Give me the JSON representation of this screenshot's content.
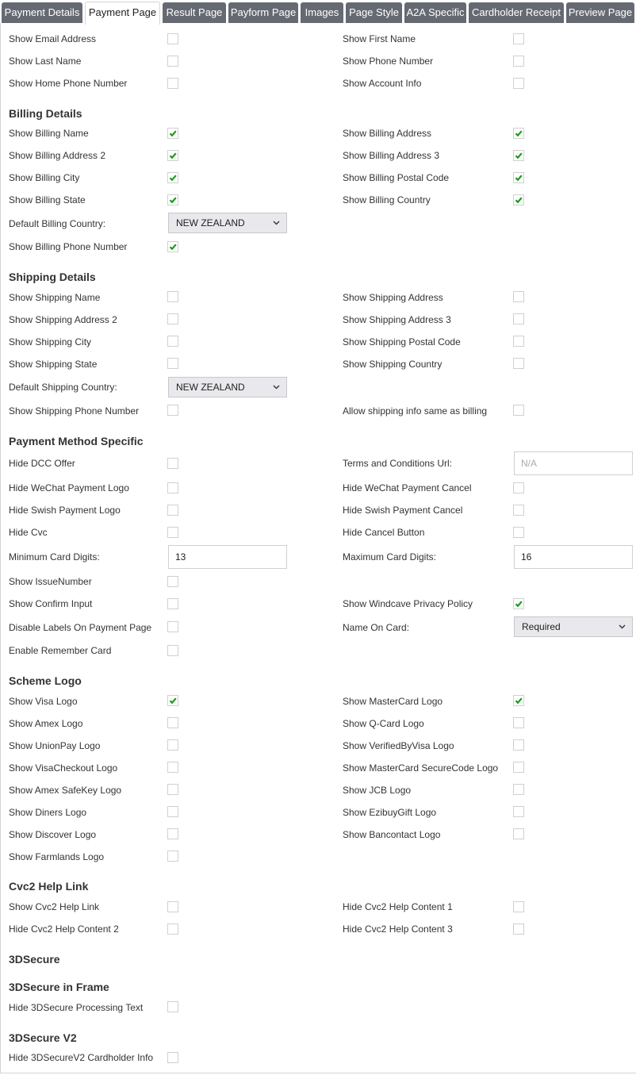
{
  "tabs": [
    {
      "label": "Payment Details",
      "active": false
    },
    {
      "label": "Payment Page",
      "active": true
    },
    {
      "label": "Result Page",
      "active": false
    },
    {
      "label": "Payform Page",
      "active": false
    },
    {
      "label": "Images",
      "active": false
    },
    {
      "label": "Page Style",
      "active": false
    },
    {
      "label": "A2A Specific",
      "active": false
    },
    {
      "label": "Cardholder Receipt",
      "active": false
    },
    {
      "label": "Preview Page",
      "active": false
    }
  ],
  "colors": {
    "tab_bg": "#656a72",
    "check_green": "#1a9a1a",
    "border": "#d4d4d4",
    "select_bg": "#e9e9ed"
  },
  "general": [
    {
      "label": "Show Email Address",
      "checked": false
    },
    {
      "label": "Show First Name",
      "checked": false
    },
    {
      "label": "Show Last Name",
      "checked": false
    },
    {
      "label": "Show Phone Number",
      "checked": false
    },
    {
      "label": "Show Home Phone Number",
      "checked": false
    },
    {
      "label": "Show Account Info",
      "checked": false
    }
  ],
  "billing": {
    "heading": "Billing Details",
    "items": [
      {
        "label": "Show Billing Name",
        "checked": true
      },
      {
        "label": "Show Billing Address",
        "checked": true
      },
      {
        "label": "Show Billing Address 2",
        "checked": true
      },
      {
        "label": "Show Billing Address 3",
        "checked": true
      },
      {
        "label": "Show Billing City",
        "checked": true
      },
      {
        "label": "Show Billing Postal Code",
        "checked": true
      },
      {
        "label": "Show Billing State",
        "checked": true
      },
      {
        "label": "Show Billing Country",
        "checked": true
      }
    ],
    "country_label": "Default Billing Country:",
    "country_value": "NEW ZEALAND",
    "phone": {
      "label": "Show Billing Phone Number",
      "checked": true
    }
  },
  "shipping": {
    "heading": "Shipping Details",
    "items": [
      {
        "label": "Show Shipping Name",
        "checked": false
      },
      {
        "label": "Show Shipping Address",
        "checked": false
      },
      {
        "label": "Show Shipping Address 2",
        "checked": false
      },
      {
        "label": "Show Shipping Address 3",
        "checked": false
      },
      {
        "label": "Show Shipping City",
        "checked": false
      },
      {
        "label": "Show Shipping Postal Code",
        "checked": false
      },
      {
        "label": "Show Shipping State",
        "checked": false
      },
      {
        "label": "Show Shipping Country",
        "checked": false
      }
    ],
    "country_label": "Default Shipping Country:",
    "country_value": "NEW ZEALAND",
    "phone": {
      "label": "Show Shipping Phone Number",
      "checked": false
    },
    "same_as_billing": {
      "label": "Allow shipping info same as billing",
      "checked": false
    }
  },
  "payment_method": {
    "heading": "Payment Method Specific",
    "hide_dcc": {
      "label": "Hide DCC Offer",
      "checked": false
    },
    "terms_label": "Terms and Conditions Url:",
    "terms_placeholder": "N/A",
    "hide_wechat_logo": {
      "label": "Hide WeChat Payment Logo",
      "checked": false
    },
    "hide_wechat_cancel": {
      "label": "Hide WeChat Payment Cancel",
      "checked": false
    },
    "hide_swish_logo": {
      "label": "Hide Swish Payment Logo",
      "checked": false
    },
    "hide_swish_cancel": {
      "label": "Hide Swish Payment Cancel",
      "checked": false
    },
    "hide_cvc": {
      "label": "Hide Cvc",
      "checked": false
    },
    "hide_cancel_button": {
      "label": "Hide Cancel Button",
      "checked": false
    },
    "min_digits_label": "Minimum Card Digits:",
    "min_digits_value": "13",
    "max_digits_label": "Maximum Card Digits:",
    "max_digits_value": "16",
    "show_issue_number": {
      "label": "Show IssueNumber",
      "checked": false
    },
    "show_confirm_input": {
      "label": "Show Confirm Input",
      "checked": false
    },
    "show_privacy_policy": {
      "label": "Show Windcave Privacy Policy",
      "checked": true
    },
    "disable_labels": {
      "label": "Disable Labels On Payment Page",
      "checked": false
    },
    "name_on_card_label": "Name On Card:",
    "name_on_card_value": "Required",
    "enable_remember_card": {
      "label": "Enable Remember Card",
      "checked": false
    }
  },
  "scheme_logo": {
    "heading": "Scheme Logo",
    "items": [
      {
        "label": "Show Visa Logo",
        "checked": true
      },
      {
        "label": "Show MasterCard Logo",
        "checked": true
      },
      {
        "label": "Show Amex Logo",
        "checked": false
      },
      {
        "label": "Show Q-Card Logo",
        "checked": false
      },
      {
        "label": "Show UnionPay Logo",
        "checked": false
      },
      {
        "label": "Show VerifiedByVisa Logo",
        "checked": false
      },
      {
        "label": "Show VisaCheckout Logo",
        "checked": false
      },
      {
        "label": "Show MasterCard SecureCode Logo",
        "checked": false
      },
      {
        "label": "Show Amex SafeKey Logo",
        "checked": false
      },
      {
        "label": "Show JCB Logo",
        "checked": false
      },
      {
        "label": "Show Diners Logo",
        "checked": false
      },
      {
        "label": "Show EzibuyGift Logo",
        "checked": false
      },
      {
        "label": "Show Discover Logo",
        "checked": false
      },
      {
        "label": "Show Bancontact Logo",
        "checked": false
      },
      {
        "label": "Show Farmlands Logo",
        "checked": false
      }
    ]
  },
  "cvc2": {
    "heading": "Cvc2 Help Link",
    "items": [
      {
        "label": "Show Cvc2 Help Link",
        "checked": false
      },
      {
        "label": "Hide Cvc2 Help Content 1",
        "checked": false
      },
      {
        "label": "Hide Cvc2 Help Content 2",
        "checked": false
      },
      {
        "label": "Hide Cvc2 Help Content 3",
        "checked": false
      }
    ]
  },
  "three_d_secure": {
    "heading": "3DSecure"
  },
  "three_d_secure_frame": {
    "heading": "3DSecure in Frame",
    "hide_processing_text": {
      "label": "Hide 3DSecure Processing Text",
      "checked": false
    }
  },
  "three_d_secure_v2": {
    "heading": "3DSecure V2",
    "hide_cardholder_info": {
      "label": "Hide 3DSecureV2 Cardholder Info",
      "checked": false
    }
  }
}
